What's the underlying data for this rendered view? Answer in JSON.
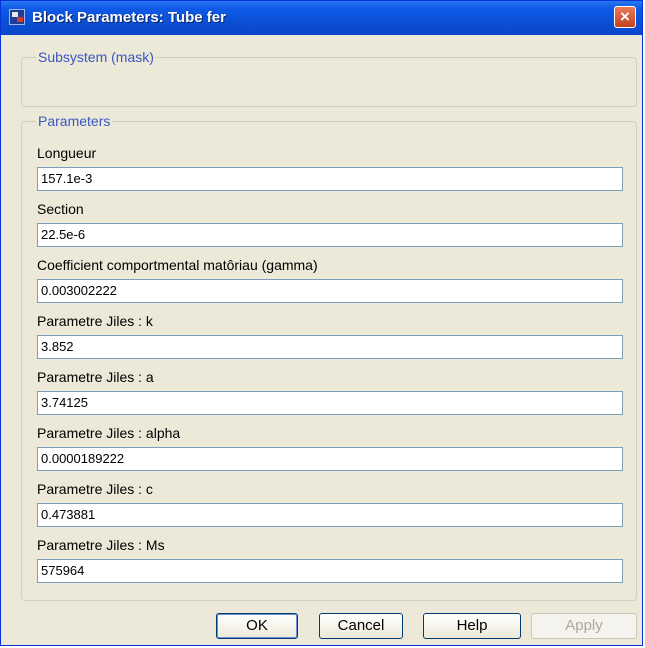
{
  "window": {
    "title": "Block Parameters: Tube fer"
  },
  "groups": {
    "mask_title": "Subsystem (mask)",
    "parameters_title": "Parameters"
  },
  "fields": [
    {
      "label": "Longueur",
      "value": "157.1e-3"
    },
    {
      "label": "Section",
      "value": "22.5e-6"
    },
    {
      "label": "Coefficient comportmental matôriau (gamma)",
      "value": "0.003002222"
    },
    {
      "label": "Parametre Jiles : k",
      "value": "3.852"
    },
    {
      "label": "Parametre Jiles : a",
      "value": "3.74125"
    },
    {
      "label": "Parametre Jiles : alpha",
      "value": "0.0000189222"
    },
    {
      "label": "Parametre Jiles : c",
      "value": "0.473881"
    },
    {
      "label": "Parametre Jiles : Ms",
      "value": "575964"
    }
  ],
  "buttons": {
    "ok": "OK",
    "cancel": "Cancel",
    "help": "Help",
    "apply": "Apply"
  },
  "icons": {
    "close": "×"
  },
  "colors": {
    "title_bar": "#0b4fd6",
    "group_title": "#3a56c4",
    "dialog_bg": "#ece9d8"
  }
}
